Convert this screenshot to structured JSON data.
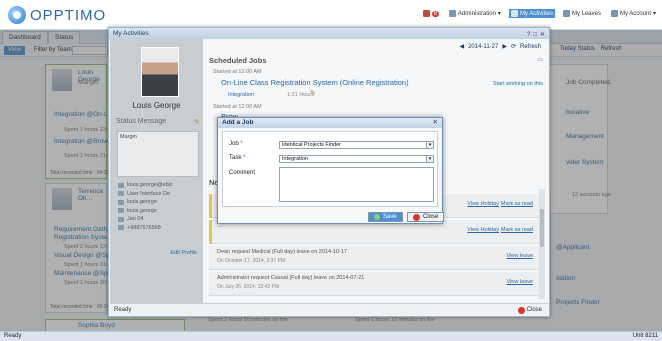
{
  "header": {
    "logo": "OPPTIMO",
    "alerts_count": "8",
    "nav": [
      {
        "label": "Administration",
        "icon": "user-admin-icon",
        "dropdown": true,
        "active": false
      },
      {
        "label": "My Activities",
        "icon": "activities-icon",
        "dropdown": false,
        "active": true
      },
      {
        "label": "My Leaves",
        "icon": "leaves-icon",
        "dropdown": false,
        "active": false
      },
      {
        "label": "My Account",
        "icon": "account-icon",
        "dropdown": true,
        "active": false
      }
    ]
  },
  "tabs": [
    "Dashboard",
    "Status"
  ],
  "toolbar": {
    "view_label": "View",
    "filter_label": "Filter by Team:"
  },
  "background": {
    "cards": [
      {
        "name": "Louis George",
        "role": "Margin",
        "items": [
          "Integration @On-Line Cl…",
          "Integration @Browsi…"
        ],
        "subs": [
          "Spent 1 hours 23 m…",
          "Spent 1 hours 31 m…"
        ],
        "footer": "Total recorded time : 04:07:1…"
      },
      {
        "name": "Terrence Oli…",
        "items": [
          "Requirement Gath…",
          "Registration Syste…",
          "Visual Design @Sp…",
          "Maintenance @Sp…"
        ],
        "subs": [
          "Spent 2 hours 12 m…",
          "Spent 1 hours 31 m…",
          "Spent 1 hours 30 m…"
        ],
        "footer": "Total recorded time : 05:14:1…"
      },
      {
        "name": "Sophia Boyd",
        "items": [],
        "subs": [
          "Spent 2 hours 50 minutes on the",
          "Spent 1 hours 12 minutes on the"
        ],
        "footer": ""
      }
    ],
    "right_texts": [
      "Job Completed.",
      "borative",
      "Management",
      "vider System",
      "12 seconds ago",
      "@Applicant",
      "station",
      "Projects Finder"
    ]
  },
  "window": {
    "title": "My Activities",
    "profile": {
      "name": "Louis George",
      "status_title": "Status Message",
      "status_text": "Margin",
      "info": [
        "louis.george@ebiz",
        "User Interface De",
        "louis.george",
        "louis.george",
        "Jan 04",
        "+9887676568"
      ],
      "edit_label": "Edit Profile"
    },
    "date": "2014-11-27",
    "refresh_label": "Refresh",
    "today_status": "Today Status",
    "scheduled_title": "Scheduled Jobs",
    "jobs": [
      {
        "time": "Started at 12:00 AM",
        "title": "On-Line Class Registration System (Online Registration)",
        "action": "Start working on this",
        "tag": "Integration",
        "duration": "1:21 Hours"
      },
      {
        "time": "Started at 12:00 AM",
        "title": "Brow…"
      }
    ],
    "notifications_title": "No…",
    "notifications": [
      {
        "text": "…",
        "date": "…",
        "link1": "View Holiday",
        "link2": "Mark as read"
      },
      {
        "text": "…",
        "date": "…",
        "link1": "View Holiday",
        "link2": "Mark as read"
      },
      {
        "text": "Dean request Medical (Full day) leave on 2014-10-17",
        "date": "On October 17, 2014, 2:37 PM",
        "link1": "",
        "link2": "View leave"
      },
      {
        "text": "Administrator request Casual (Full day) leave on 2014-07-21",
        "date": "On July 26, 2014, 12:42 PM",
        "link1": "",
        "link2": "View leave"
      }
    ],
    "footer_status": "Ready",
    "close_label": "Close"
  },
  "dialog": {
    "title": "Add a Job",
    "job_label": "Job",
    "job_value": "Identical Projects Finder",
    "task_label": "Task",
    "task_value": "Integration",
    "comment_label": "Comment",
    "comment_value": "",
    "save_label": "Save",
    "close_label": "Close"
  },
  "statusbar": {
    "left": "Ready",
    "right": "Unit 8211"
  }
}
